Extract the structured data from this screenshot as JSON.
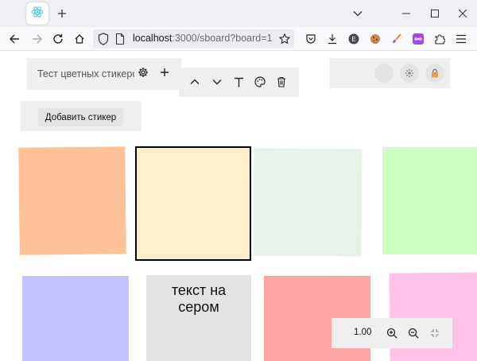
{
  "browser": {
    "url_host": "localhost",
    "url_rest": ":3000/sboard?board=1"
  },
  "toolbar": {
    "title_placeholder": "Тест цветных стикерс",
    "add_sticker_label": "Добавить стикер"
  },
  "stickers": [
    {
      "color": "#ffc196",
      "text": ""
    },
    {
      "color": "#fdf0cb",
      "text": "",
      "selected": true
    },
    {
      "color": "#e7f3e9",
      "text": ""
    },
    {
      "color": "#ccffc2",
      "text": ""
    },
    {
      "color": "#c5c4ff",
      "text": ""
    },
    {
      "color": "#e3e4e3",
      "text": "текст на сером"
    },
    {
      "color": "#ffa4a4",
      "text": ""
    },
    {
      "color": "#ffc3e8",
      "text": ""
    }
  ],
  "zoom": {
    "value": "1.00"
  }
}
